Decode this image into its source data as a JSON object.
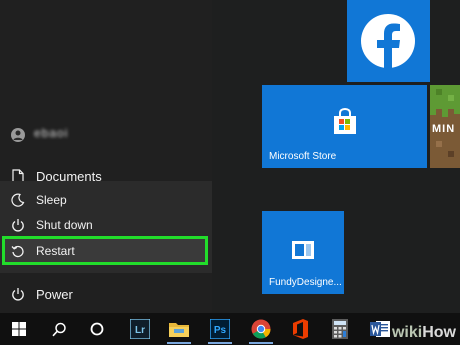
{
  "start_menu": {
    "user": {
      "name": "ebaoi"
    },
    "documents_label": "Documents",
    "power_options": [
      {
        "label": "Sleep",
        "icon": "moon-icon"
      },
      {
        "label": "Shut down",
        "icon": "power-icon"
      },
      {
        "label": "Restart",
        "icon": "restart-icon"
      }
    ],
    "power_label": "Power",
    "highlight_color": "#22dd2b"
  },
  "tiles": {
    "facebook": {
      "letter": "f"
    },
    "store": {
      "label": "Microsoft Store"
    },
    "fundy": {
      "label": "FundyDesigne..."
    },
    "minecraft": {
      "text": "MIN"
    }
  },
  "taskbar": {
    "items": [
      {
        "name": "start-button",
        "icon": "windows-icon"
      },
      {
        "name": "search",
        "icon": "search-icon"
      },
      {
        "name": "cortana",
        "icon": "cortana-icon"
      },
      {
        "name": "lightroom",
        "icon": "lightroom-icon",
        "text": "Lr"
      },
      {
        "name": "file-explorer",
        "icon": "folder-icon"
      },
      {
        "name": "photoshop",
        "icon": "photoshop-icon",
        "text": "Ps"
      },
      {
        "name": "chrome",
        "icon": "chrome-icon"
      },
      {
        "name": "office",
        "icon": "office-icon"
      },
      {
        "name": "calculator",
        "icon": "calculator-icon"
      },
      {
        "name": "word",
        "icon": "word-icon"
      }
    ]
  },
  "watermark": {
    "part1": "wiki",
    "part2": "How"
  },
  "colors": {
    "tile_blue": "#1177d6",
    "menu_bg": "#202020",
    "taskbar_bg": "#101010"
  }
}
